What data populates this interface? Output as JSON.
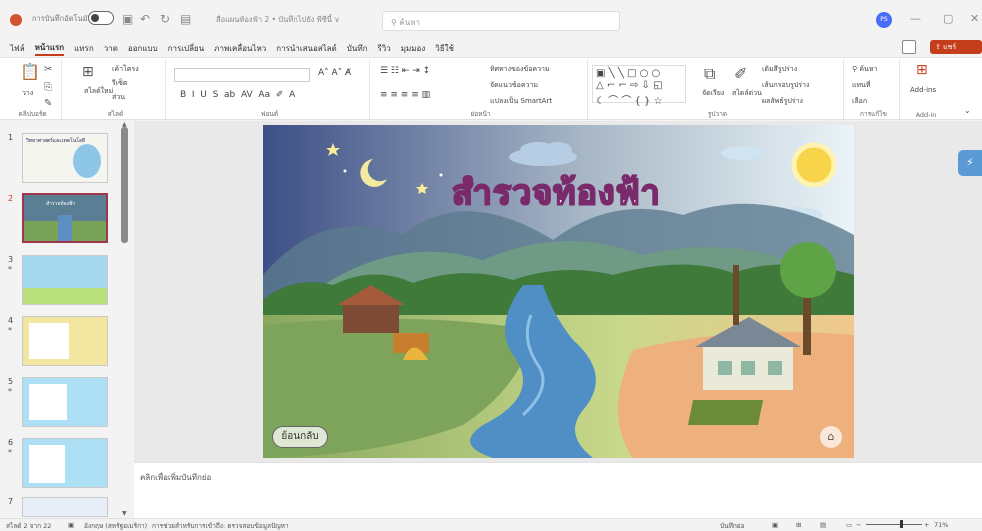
{
  "titlebar": {
    "autosave": "การบันทึกอัตโนมัติ",
    "doc_title": "สื่อแผนท้องฟ้า 2 • บันทึกไปยัง พีซีนี้ ∨",
    "search_placeholder": "ค้นหา",
    "avatar": "PS"
  },
  "menu": [
    "ไฟล์",
    "หน้าแรก",
    "แทรก",
    "วาด",
    "ออกแบบ",
    "การเปลี่ยน",
    "ภาพเคลื่อนไหว",
    "การนำเสนอสไลด์",
    "บันทึก",
    "รีวิว",
    "มุมมอง",
    "วิธีใช้"
  ],
  "share_label": "แชร์",
  "ribbon": {
    "clipboard": {
      "paste": "วาง",
      "label": "คลิปบอร์ด"
    },
    "slides": {
      "new_slide": "สไลด์ใหม่",
      "layout": "เค้าโครง",
      "reset": "รีเซ็ต",
      "section": "ส่วน",
      "label": "สไลด์"
    },
    "font": {
      "label": "ฟอนต์"
    },
    "paragraph": {
      "text_direction": "ทิศทางของข้อความ",
      "align_text": "จัดแนวข้อความ",
      "smartart": "แปลงเป็น SmartArt",
      "label": "ย่อหน้า"
    },
    "drawing": {
      "arrange": "จัดเรียง",
      "quick_styles": "สไตล์ด่วน",
      "shape_fill": "เติมสีรูปร่าง",
      "shape_outline": "เส้นกรอบรูปร่าง",
      "shape_effects": "ผลลัพธ์รูปร่าง",
      "label": "รูปวาด"
    },
    "editing": {
      "find": "ค้นหา",
      "replace": "แทนที่",
      "select": "เลือก",
      "label": "การแก้ไข"
    },
    "addins": {
      "button": "Add-ins",
      "label": "Add-in"
    }
  },
  "slide": {
    "title": "สำรวจท้องฟ้า",
    "back_button": "ย้อนกลับ"
  },
  "thumbs": [
    {
      "num": "1",
      "star": false,
      "title": "วิทยาศาสตร์และเทคโนโลยี"
    },
    {
      "num": "2",
      "star": false,
      "title": "สำรวจท้องฟ้า"
    },
    {
      "num": "3",
      "star": true,
      "title": ""
    },
    {
      "num": "4",
      "star": true,
      "title": ""
    },
    {
      "num": "5",
      "star": true,
      "title": ""
    },
    {
      "num": "6",
      "star": true,
      "title": ""
    },
    {
      "num": "7",
      "star": false,
      "title": ""
    }
  ],
  "notes_placeholder": "คลิกเพื่อเพิ่มบันทึกย่อ",
  "status": {
    "slide_of": "สไลด์ 2 จาก 22",
    "language": "อังกฤษ (สหรัฐอเมริกา)",
    "accessibility": "การช่วยสำหรับการเข้าถึง: ตรวจสอบข้อมูลปัญหา",
    "notes": "บันทึกย่อ",
    "zoom": "71%"
  }
}
